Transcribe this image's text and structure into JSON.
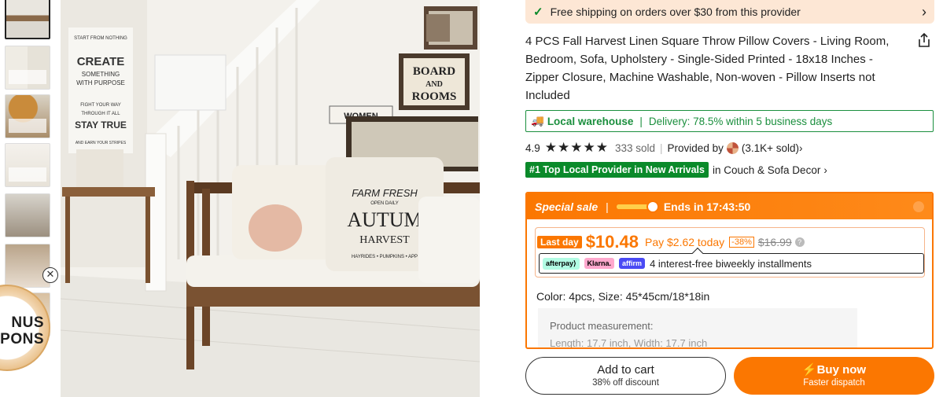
{
  "shipping": {
    "text": "Free shipping on orders over $30 from this provider"
  },
  "product": {
    "title": "4 PCS Fall Harvest Linen Square Throw Pillow Covers - Living Room, Bedroom, Sofa, Upholstery - Single-Sided Printed - 18x18 Inches - Zipper Closure, Machine Washable, Non-woven - Pillow Inserts not Included"
  },
  "warehouse": {
    "label": "Local warehouse",
    "delivery": "Delivery: 78.5% within 5 business days"
  },
  "rating": {
    "score": "4.9",
    "stars": "★★★★★",
    "sold": "333 sold",
    "provided_by": "Provided by",
    "provider_sold": "(3.1K+ sold)"
  },
  "badge": {
    "label": "#1 Top Local Provider in New Arrivals",
    "category": "in Couch & Sofa Decor"
  },
  "sale": {
    "label": "Special sale",
    "ends": "Ends in 17:43:50",
    "last_day": "Last day",
    "price": "$10.48",
    "pay_today": "Pay $2.62 today",
    "discount": "-38%",
    "original": "$16.99",
    "installments": "4 interest-free biweekly installments",
    "pay_logos": [
      "afterpay⟩",
      "Klarna.",
      "affirm"
    ]
  },
  "options": {
    "color_size": "Color: 4pcs, Size: 45*45cm/18*18in"
  },
  "measurement": {
    "heading": "Product measurement:",
    "line2": "Length: 17.7 inch, Width: 17.7 inch"
  },
  "bonus": {
    "line1": "NUS",
    "line2": "PONS"
  },
  "image_text": {
    "sign_top": "START FROM NOTHING",
    "sign_create": "CREATE",
    "sign_something": "SOMETHING",
    "sign_purpose": "WITH PURPOSE",
    "sign_fight": "FIGHT YOUR WAY",
    "sign_through": "THROUGH IT ALL",
    "sign_stay": "STAY TRUE",
    "sign_earn": "AND EARN YOUR STRIPES",
    "board1": "BOARD",
    "board2": "AND",
    "board3": "ROOMS",
    "women": "WOMEN",
    "farm": "FARM FRESH",
    "open": "OPEN DAILY",
    "autumn": "AUTUM",
    "harvest": "HARVEST",
    "hayrides": "HAYRIDES • PUMPKINS • APP"
  },
  "actions": {
    "cart": "Add to cart",
    "cart_sub": "38% off discount",
    "buy": "Buy now",
    "buy_sub": "Faster dispatch"
  },
  "colors": {
    "accent": "#fb7701",
    "green": "#0a8a2a"
  }
}
